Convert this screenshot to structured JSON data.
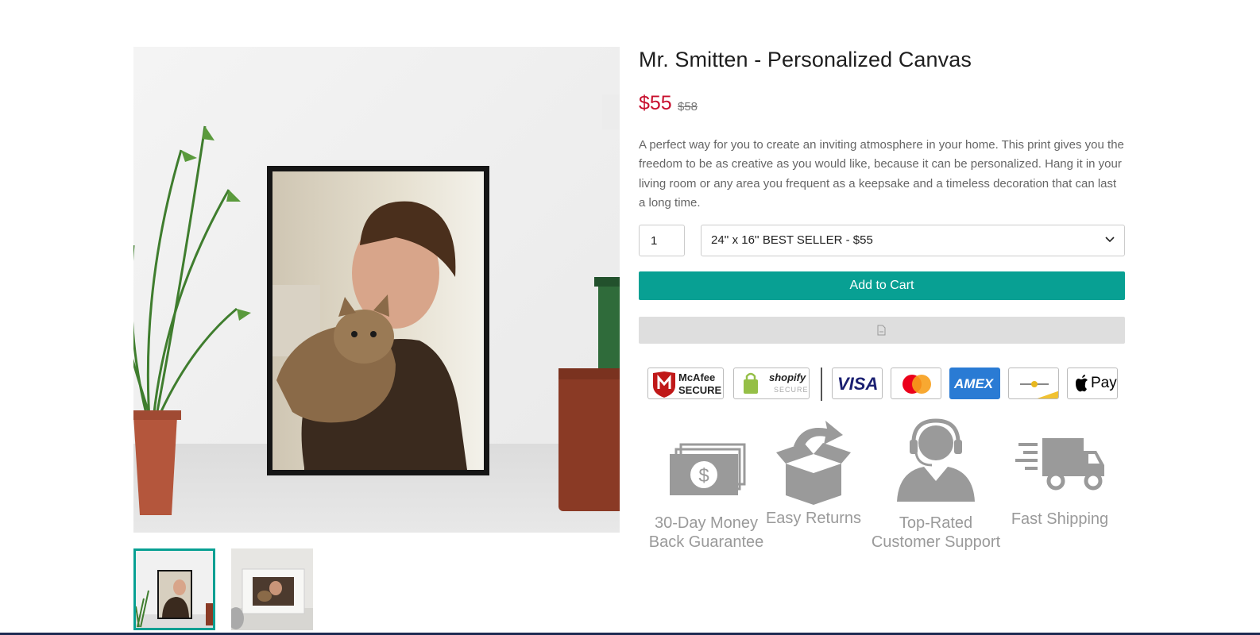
{
  "product": {
    "title": "Mr. Smitten - Personalized Canvas",
    "price": "$55",
    "compare_price": "$58",
    "description": "A perfect way for you to create an inviting atmosphere in your home. This print gives you the freedom to be as creative as you would like, because it can be personalized. Hang it in your living room or any area you frequent as a keepsake and a timeless decoration that can last a long time.",
    "quantity": "1",
    "variant_selected": "24'' x 16'' BEST SELLER - $55",
    "add_to_cart_label": "Add to Cart"
  },
  "badges": {
    "mcafee_line1": "McAfee",
    "mcafee_line2": "SECURE",
    "shopify_line1": "shopify",
    "shopify_line2": "SECURE",
    "visa": "VISA",
    "amex": "AMEX",
    "applepay": "Pay"
  },
  "trust": [
    {
      "label": "30-Day Money\nBack Guarantee",
      "icon": "money-icon"
    },
    {
      "label": "Easy Returns",
      "icon": "return-box-icon"
    },
    {
      "label": "Top-Rated\nCustomer Support",
      "icon": "support-agent-icon"
    },
    {
      "label": "Fast Shipping",
      "icon": "truck-icon"
    }
  ],
  "colors": {
    "accent": "#08a093",
    "price": "#c8102e",
    "trust_gray": "#9a9a9a"
  }
}
